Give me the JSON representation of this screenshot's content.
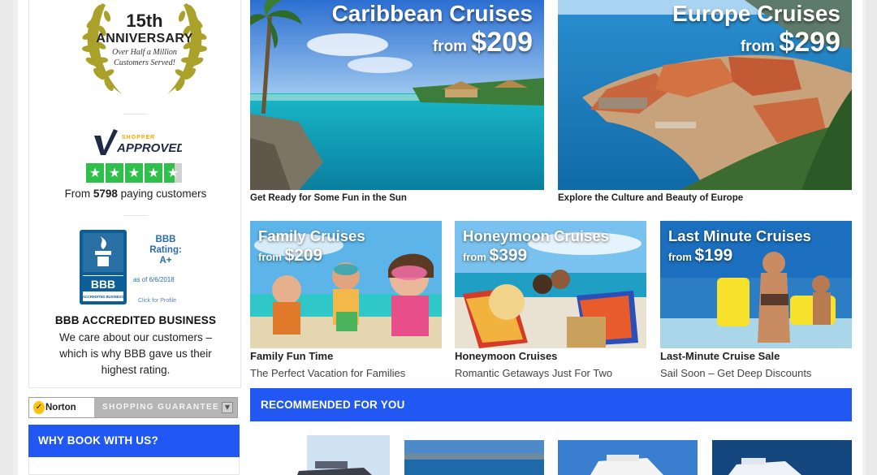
{
  "sidebar": {
    "anniversary": {
      "number": "15th",
      "word": "ANNIVERSARY",
      "line1": "Over Half a Million",
      "line2": "Customers Served!"
    },
    "shopper_approved": {
      "logo_small": "SHOPPER",
      "logo_big": "APPROVED",
      "rating_stars": 4.5,
      "from_prefix": "From ",
      "customers_count": "5798",
      "from_suffix": " paying customers"
    },
    "bbb": {
      "badge_text": "BBB",
      "badge_sub": "ACCREDITED BUSINESS",
      "rating_line1": "BBB",
      "rating_line2": "Rating:",
      "rating_value": "A+",
      "as_of": "as of 6/6/2018",
      "click": "Click for Profile",
      "title": "BBB ACCREDITED BUSINESS",
      "description": "We care about our customers – which is why BBB gave us their highest rating."
    },
    "norton": {
      "brand": "Norton",
      "label": "SHOPPING GUARANTEE"
    },
    "why_book": "WHY BOOK WITH US?"
  },
  "featured": [
    {
      "name": "Caribbean Cruises",
      "from": "from",
      "price": "$209",
      "caption": "Get Ready for Some Fun in the Sun"
    },
    {
      "name": "Europe Cruises",
      "from": "from",
      "price": "$299",
      "caption": "Explore the Culture and Beauty of Europe"
    }
  ],
  "deals": [
    {
      "name": "Family Cruises",
      "from": "from",
      "price": "$209",
      "title": "Family Fun Time",
      "subtitle": "The Perfect Vacation for Families"
    },
    {
      "name": "Honeymoon Cruises",
      "from": "from",
      "price": "$399",
      "title": "Honeymoon Cruises",
      "subtitle": "Romantic Getaways Just For Two"
    },
    {
      "name": "Last Minute Cruises",
      "from": "from",
      "price": "$199",
      "title": "Last-Minute Cruise Sale",
      "subtitle": "Sail Soon – Get Deep Discounts"
    }
  ],
  "recommended": {
    "heading": "RECOMMENDED FOR YOU"
  },
  "colors": {
    "accent_blue": "#2157f2",
    "star_green": "#2ec04a",
    "bbb_blue": "#0c5e98",
    "laurel_gold": "#a9a12a"
  }
}
